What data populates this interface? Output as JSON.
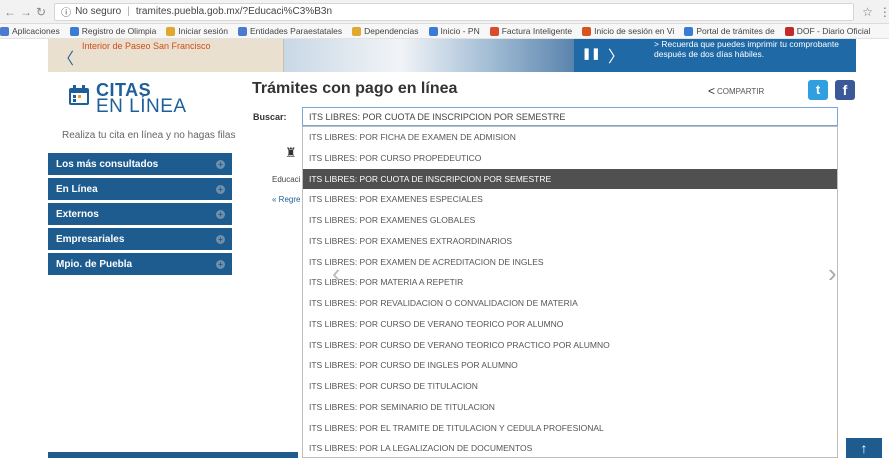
{
  "browser": {
    "security_label": "No seguro",
    "url": "tramites.puebla.gob.mx/?Educaci%C3%B3n",
    "bookmarks": [
      {
        "label": "Aplicaciones",
        "color": "#4a7bd1"
      },
      {
        "label": "Registro de Olimpia",
        "color": "#3a7bd5"
      },
      {
        "label": "Iniciar sesión",
        "color": "#e0a82e"
      },
      {
        "label": "Entidades Paraestatales",
        "color": "#4a7bd1"
      },
      {
        "label": "Dependencias",
        "color": "#e0a82e"
      },
      {
        "label": "Inicio - PN",
        "color": "#3a7bd5"
      },
      {
        "label": "Factura Inteligente",
        "color": "#d94b2b"
      },
      {
        "label": "Inicio de sesión en Vi",
        "color": "#d9531e"
      },
      {
        "label": "Portal de trámites de",
        "color": "#3a7bd5"
      },
      {
        "label": "DOF - Diario Oficial",
        "color": "#c62828"
      }
    ]
  },
  "banner": {
    "left_text": "Interior de Paseo San Francisco",
    "notice": "> Recuerda que puedes imprimir tu comprobante después de dos días hábiles."
  },
  "logo": {
    "citas": "CITAS",
    "en_linea": "EN LÍNEA",
    "tagline": "Realiza tu cita en línea y no hagas filas"
  },
  "sidebar": {
    "items": [
      {
        "label": "Los más consultados"
      },
      {
        "label": "En Línea"
      },
      {
        "label": "Externos"
      },
      {
        "label": "Empresariales"
      },
      {
        "label": "Mpio. de Puebla"
      }
    ]
  },
  "main": {
    "title": "Trámites con pago en línea",
    "share_label": "COMPARTIR",
    "search_label": "Buscar:",
    "search_value": "ITS LIBRES: POR CUOTA DE INSCRIPCION POR SEMESTRE",
    "education_label": "Educaci",
    "back_link": "« Regre"
  },
  "dropdown": {
    "selected_index": 2,
    "options": [
      "ITS LIBRES: POR FICHA DE EXAMEN DE ADMISION",
      "ITS LIBRES: POR CURSO PROPEDEUTICO",
      "ITS LIBRES: POR CUOTA DE INSCRIPCION POR SEMESTRE",
      "ITS LIBRES: POR EXAMENES ESPECIALES",
      "ITS LIBRES: POR EXAMENES GLOBALES",
      "ITS LIBRES: POR EXAMENES EXTRAORDINARIOS",
      "ITS LIBRES: POR EXAMEN DE ACREDITACION DE INGLES",
      "ITS LIBRES: POR MATERIA A REPETIR",
      "ITS LIBRES: POR REVALIDACION O CONVALIDACION DE MATERIA",
      "ITS LIBRES: POR CURSO DE VERANO TEORICO POR ALUMNO",
      "ITS LIBRES: POR CURSO DE VERANO TEORICO PRACTICO POR ALUMNO",
      "ITS LIBRES: POR CURSO DE INGLES POR ALUMNO",
      "ITS LIBRES: POR CURSO DE TITULACION",
      "ITS LIBRES: POR SEMINARIO DE TITULACION",
      "ITS LIBRES: POR EL TRAMITE DE TITULACION Y CEDULA PROFESIONAL",
      "ITS LIBRES: POR LA LEGALIZACION DE DOCUMENTOS"
    ]
  },
  "colors": {
    "brand_blue": "#1e5b8f",
    "selected_option": "#505050"
  }
}
